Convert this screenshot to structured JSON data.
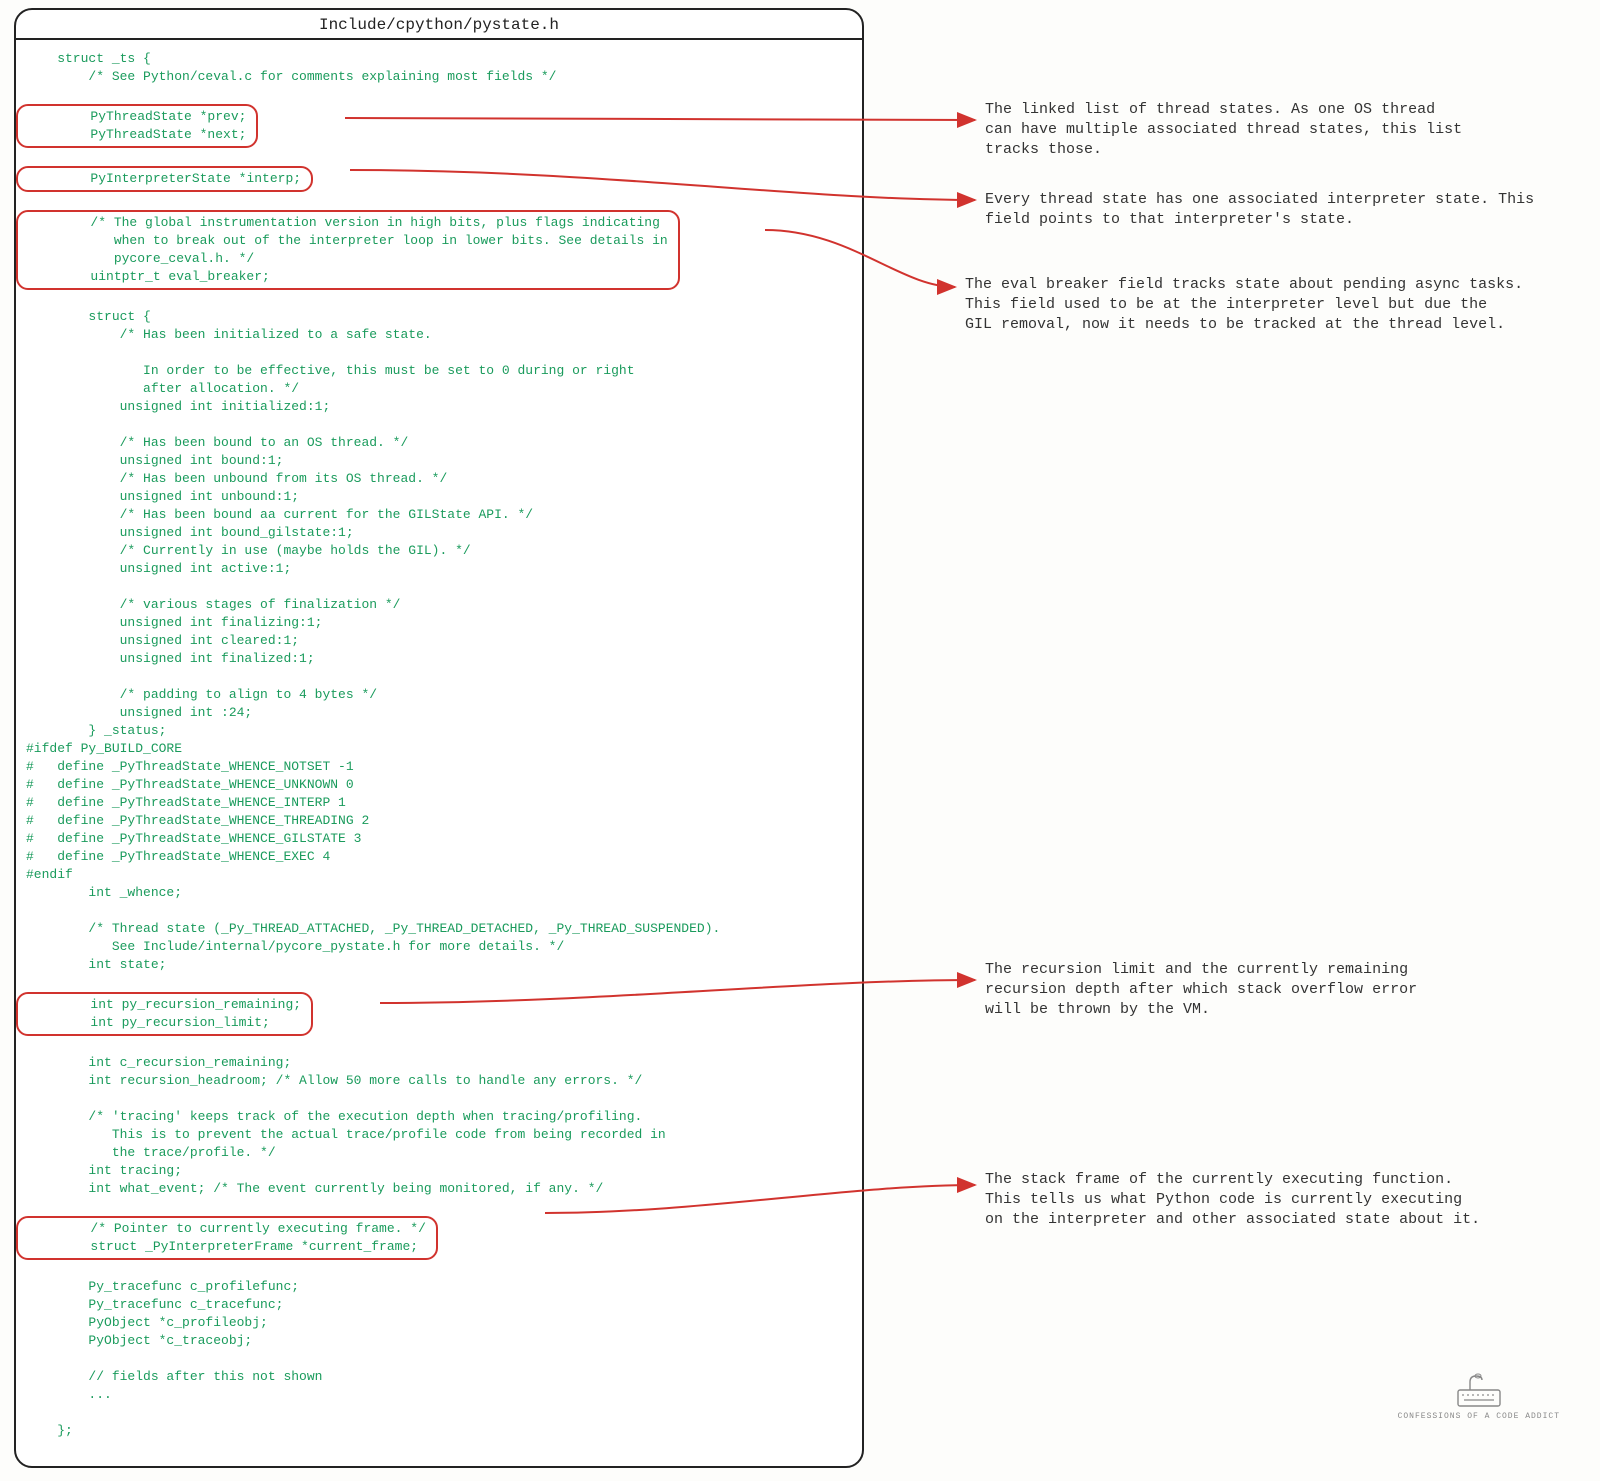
{
  "title": "Include/cpython/pystate.h",
  "code": {
    "l0": "    struct _ts {",
    "l1": "        /* See Python/ceval.c for comments explaining most fields */",
    "l2": "",
    "box1a": "        PyThreadState *prev;",
    "box1b": "        PyThreadState *next;",
    "l3": "",
    "box2": "        PyInterpreterState *interp;",
    "l4": "",
    "box3a": "        /* The global instrumentation version in high bits, plus flags indicating",
    "box3b": "           when to break out of the interpreter loop in lower bits. See details in",
    "box3c": "           pycore_ceval.h. */",
    "box3d": "        uintptr_t eval_breaker;",
    "l5": "",
    "l6": "        struct {",
    "l7": "            /* Has been initialized to a safe state.",
    "l8": "",
    "l9": "               In order to be effective, this must be set to 0 during or right",
    "l10": "               after allocation. */",
    "l11": "            unsigned int initialized:1;",
    "l12": "",
    "l13": "            /* Has been bound to an OS thread. */",
    "l14": "            unsigned int bound:1;",
    "l15": "            /* Has been unbound from its OS thread. */",
    "l16": "            unsigned int unbound:1;",
    "l17": "            /* Has been bound aa current for the GILState API. */",
    "l18": "            unsigned int bound_gilstate:1;",
    "l19": "            /* Currently in use (maybe holds the GIL). */",
    "l20": "            unsigned int active:1;",
    "l21": "",
    "l22": "            /* various stages of finalization */",
    "l23": "            unsigned int finalizing:1;",
    "l24": "            unsigned int cleared:1;",
    "l25": "            unsigned int finalized:1;",
    "l26": "",
    "l27": "            /* padding to align to 4 bytes */",
    "l28": "            unsigned int :24;",
    "l29": "        } _status;",
    "l30": "#ifdef Py_BUILD_CORE",
    "l31": "#   define _PyThreadState_WHENCE_NOTSET -1",
    "l32": "#   define _PyThreadState_WHENCE_UNKNOWN 0",
    "l33": "#   define _PyThreadState_WHENCE_INTERP 1",
    "l34": "#   define _PyThreadState_WHENCE_THREADING 2",
    "l35": "#   define _PyThreadState_WHENCE_GILSTATE 3",
    "l36": "#   define _PyThreadState_WHENCE_EXEC 4",
    "l37": "#endif",
    "l38": "        int _whence;",
    "l39": "",
    "l40": "        /* Thread state (_Py_THREAD_ATTACHED, _Py_THREAD_DETACHED, _Py_THREAD_SUSPENDED).",
    "l41": "           See Include/internal/pycore_pystate.h for more details. */",
    "l42": "        int state;",
    "l43": "",
    "box4a": "        int py_recursion_remaining;",
    "box4b": "        int py_recursion_limit;",
    "l44": "",
    "l45": "        int c_recursion_remaining;",
    "l46": "        int recursion_headroom; /* Allow 50 more calls to handle any errors. */",
    "l47": "",
    "l48": "        /* 'tracing' keeps track of the execution depth when tracing/profiling.",
    "l49": "           This is to prevent the actual trace/profile code from being recorded in",
    "l50": "           the trace/profile. */",
    "l51": "        int tracing;",
    "l52": "        int what_event; /* The event currently being monitored, if any. */",
    "l53": "",
    "box5a": "        /* Pointer to currently executing frame. */",
    "box5b": "        struct _PyInterpreterFrame *current_frame;",
    "l54": "",
    "l55": "        Py_tracefunc c_profilefunc;",
    "l56": "        Py_tracefunc c_tracefunc;",
    "l57": "        PyObject *c_profileobj;",
    "l58": "        PyObject *c_traceobj;",
    "l59": "",
    "l60": "        // fields after this not shown",
    "l61": "        ...",
    "l62": "",
    "l63": "    };"
  },
  "annotations": {
    "a1": "The linked list of thread states. As one OS thread\ncan have multiple associated thread states, this list\ntracks those.",
    "a2": "Every thread state has one associated interpreter state. This\nfield points to that interpreter's state.",
    "a3": "The eval breaker field tracks state about pending async tasks.\nThis field used to be at the interpreter level but due the\nGIL removal, now it needs to be tracked at the thread level.",
    "a4": "The recursion limit and the currently remaining\nrecursion depth after which stack overflow error\nwill be thrown by the VM.",
    "a5": "The stack frame of the currently executing function.\nThis tells us what Python code is currently executing\non the interpreter and other associated state about it."
  },
  "watermark": "CONFESSIONS OF A CODE ADDICT"
}
